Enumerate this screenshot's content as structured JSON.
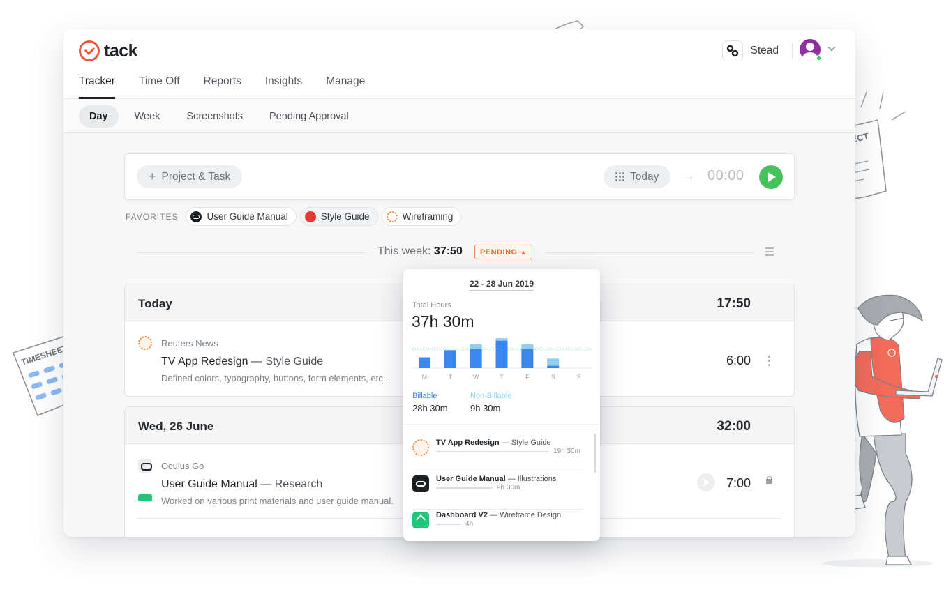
{
  "app": {
    "brand": "tack",
    "nav": [
      "Tracker",
      "Time Off",
      "Reports",
      "Insights",
      "Manage"
    ],
    "org_name": "Stead"
  },
  "subnav": [
    "Day",
    "Week",
    "Screenshots",
    "Pending Approval"
  ],
  "entry": {
    "project_placeholder": "Project & Task",
    "date_label": "Today",
    "timer": "00:00"
  },
  "favorites": {
    "label": "FAVORITES",
    "items": [
      "User Guide Manual",
      "Style Guide",
      "Wireframing"
    ]
  },
  "week": {
    "prefix": "This week:",
    "total": "37:50",
    "status": "PENDING"
  },
  "days": [
    {
      "title": "Today",
      "total": "17:50",
      "entries": [
        {
          "client": "Reuters News",
          "task": "TV App Redesign",
          "subtask": "— Style Guide",
          "desc": "Defined colors, typography, buttons, form elements, etc...",
          "time": "6:00"
        }
      ]
    },
    {
      "title": "Wed, 26 June",
      "total": "32:00",
      "entries": [
        {
          "client": "Oculus Go",
          "task": "User Guide Manual",
          "subtask": "— Research",
          "desc": "Worked on various print materials and user guide manual.",
          "time": "7:00"
        }
      ]
    }
  ],
  "popover": {
    "range": "22 - 28 Jun 2019",
    "total_label": "Total Hours",
    "total": "37h 30m",
    "billable_label": "Billable",
    "billable_value": "28h 30m",
    "nonbillable_label": "Non-Billable",
    "nonbillable_value": "9h 30m",
    "projects": [
      {
        "name": "TV App Redesign",
        "sub": "— Style Guide",
        "dur": "19h 30m",
        "share": 0.9
      },
      {
        "name": "User Guide Manual",
        "sub": "— Illustrations",
        "dur": "9h 30m",
        "share": 0.45
      },
      {
        "name": "Dashboard V2",
        "sub": "— Wireframe Design",
        "dur": "4h",
        "share": 0.2
      }
    ]
  },
  "chart_data": {
    "type": "bar",
    "categories": [
      "M",
      "T",
      "W",
      "T",
      "F",
      "S",
      "S"
    ],
    "series": [
      {
        "name": "Billable",
        "values": [
          4.5,
          7.5,
          8.0,
          11.5,
          8.0,
          1.0,
          0
        ]
      },
      {
        "name": "Non-Billable",
        "values": [
          0,
          0,
          2.0,
          1.0,
          2.0,
          3.0,
          0
        ]
      }
    ],
    "colors": {
      "billable": "#3b86f0",
      "nonbillable": "#8fd0f0",
      "target": "#55c47a"
    },
    "ylim": [
      0,
      14
    ],
    "target_line": 8
  },
  "illustrations": {
    "left_paper_text": "TIMESHEET",
    "right_paper_text": "PROJECT"
  }
}
